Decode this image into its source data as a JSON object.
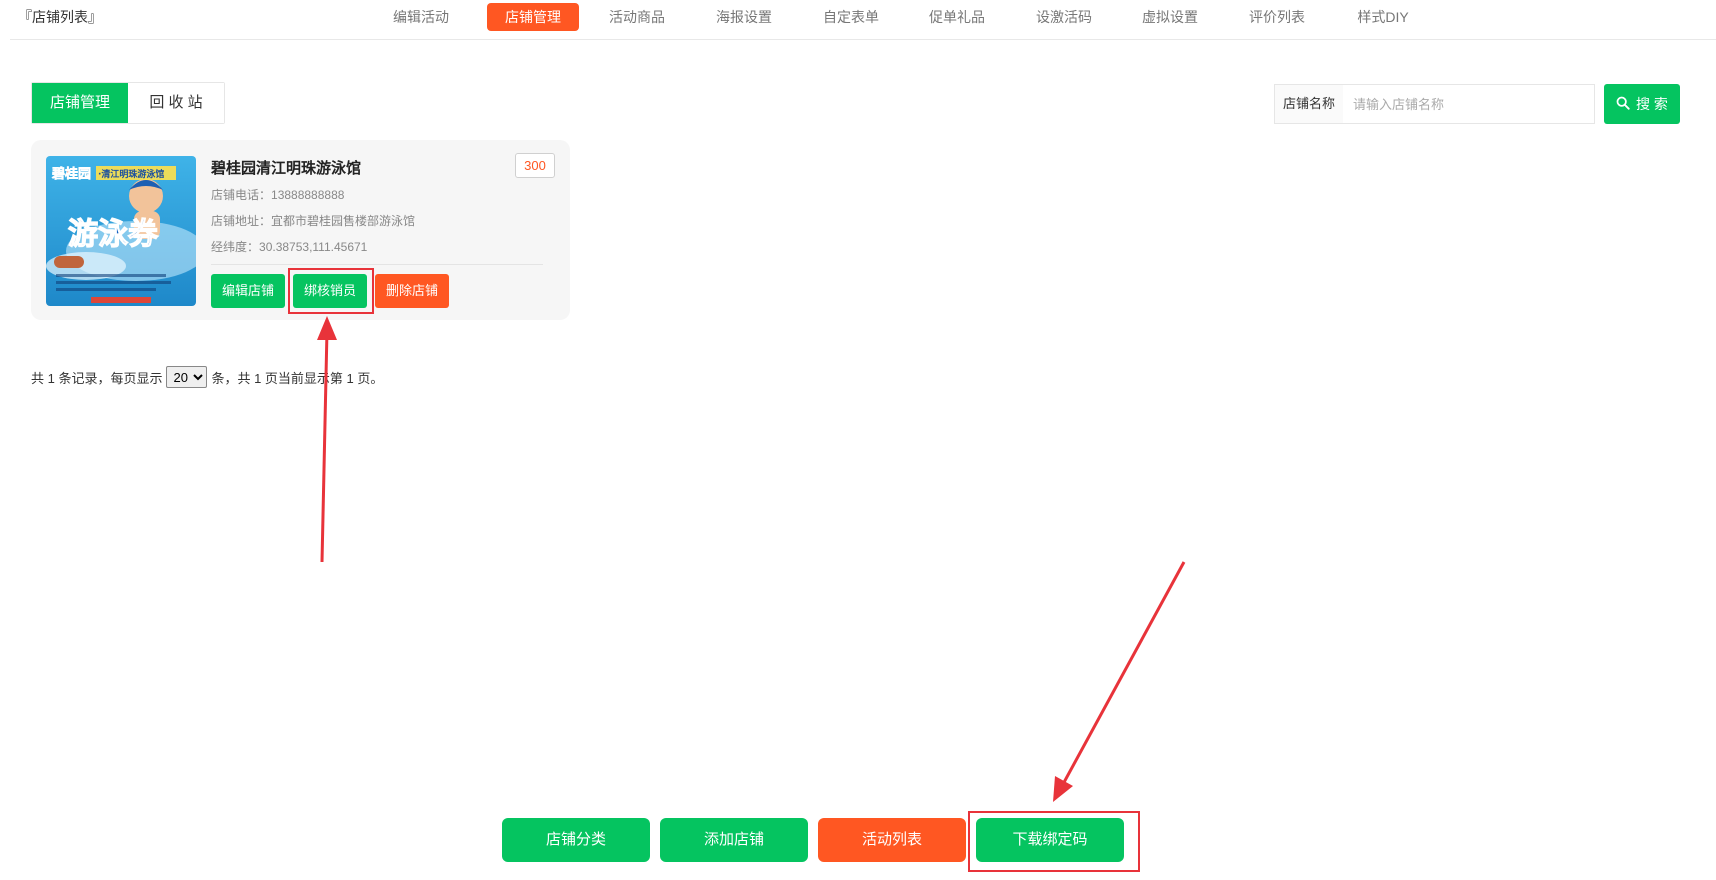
{
  "header": {
    "title": "『店铺列表』",
    "nav": [
      {
        "label": "编辑活动",
        "active": false
      },
      {
        "label": "店铺管理",
        "active": true
      },
      {
        "label": "活动商品",
        "active": false
      },
      {
        "label": "海报设置",
        "active": false
      },
      {
        "label": "自定表单",
        "active": false
      },
      {
        "label": "促单礼品",
        "active": false
      },
      {
        "label": "设激活码",
        "active": false
      },
      {
        "label": "虚拟设置",
        "active": false
      },
      {
        "label": "评价列表",
        "active": false
      },
      {
        "label": "样式DIY",
        "active": false
      }
    ]
  },
  "subtabs": {
    "manage": "店铺管理",
    "recycle": "回 收 站"
  },
  "search": {
    "label": "店铺名称",
    "placeholder": "请输入店铺名称",
    "value": "",
    "button": "搜 索"
  },
  "store": {
    "image_text": {
      "brand": "碧桂园",
      "sub": "·清江明珠游泳馆",
      "headline": "游泳券"
    },
    "name": "碧桂园清江明珠游泳馆",
    "badge": "300",
    "phone_label": "店铺电话：",
    "phone": "13888888888",
    "address_label": "店铺地址：",
    "address": "宜都市碧桂园售楼部游泳馆",
    "coords_label": "经纬度：",
    "coords": "30.38753,111.45671",
    "buttons": {
      "edit": "编辑店铺",
      "bind": "绑核销员",
      "delete": "删除店铺"
    }
  },
  "pager": {
    "before": "共 1 条记录，每页显示",
    "per_page": "20",
    "after": "条，共 1 页当前显示第 1 页。"
  },
  "bottom": {
    "category": "店铺分类",
    "add": "添加店铺",
    "activity_list": "活动列表",
    "download": "下载绑定码"
  },
  "colors": {
    "green": "#05c460",
    "orange": "#ff5722",
    "annotation_red": "#e8333a"
  }
}
